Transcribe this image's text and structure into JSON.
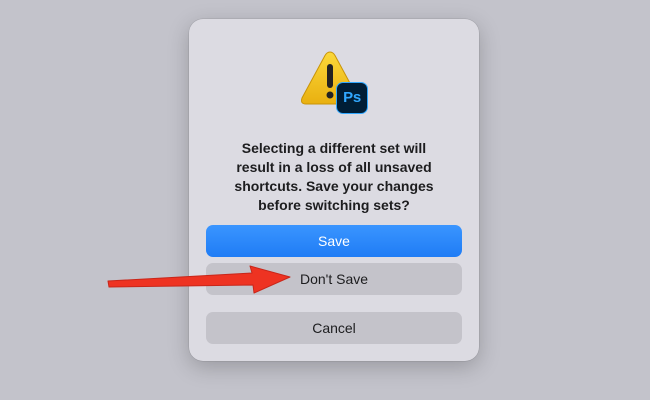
{
  "dialog": {
    "message": "Selecting a different set will\nresult in a loss of all unsaved\nshortcuts.  Save your changes\nbefore switching sets?",
    "app_badge": "Ps",
    "buttons": {
      "save_label": "Save",
      "dont_save_label": "Don't Save",
      "cancel_label": "Cancel"
    }
  },
  "colors": {
    "accent": "#1f7cf5",
    "annotation_arrow": "#ee3322",
    "warning": "#f5c518",
    "ps_badge_bg": "#001e36",
    "ps_badge_fg": "#31a8ff"
  },
  "icons": {
    "alert": "warning-triangle-icon",
    "app": "photoshop-app-icon"
  }
}
